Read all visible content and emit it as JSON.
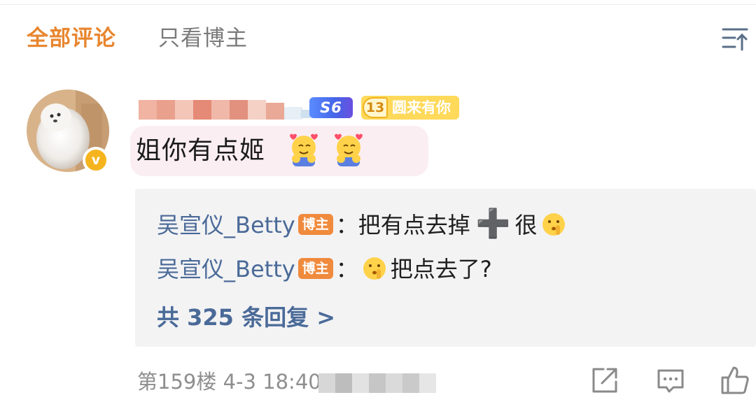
{
  "tabs": {
    "all_comments": "全部评论",
    "only_op": "只看博主"
  },
  "comment": {
    "level_badge": "S6",
    "fan_badge": {
      "level": "13",
      "name": "圆来有你"
    },
    "verified_mark": "v",
    "text": "姐你有点姬",
    "emoji": "hug-emoji"
  },
  "replies": {
    "items": [
      {
        "author": "吴宣仪_Betty",
        "tag": "博主",
        "separator": "：",
        "text_before": "把有点去掉",
        "plus": "➕",
        "text_after": "很",
        "emoji": "shh-emoji"
      },
      {
        "author": "吴宣仪_Betty",
        "tag": "博主",
        "separator": "：",
        "emoji": "shh-emoji",
        "text": "把点去了?"
      }
    ],
    "more_label": "共 325 条回复 >"
  },
  "footer": {
    "meta": "第159楼 4-3 18:40"
  },
  "colors": {
    "tab_active": "#e8862f",
    "reply_author": "#4a6a98",
    "op_tag": "#f08a3c",
    "bubble_bg": "#fbeef2"
  }
}
